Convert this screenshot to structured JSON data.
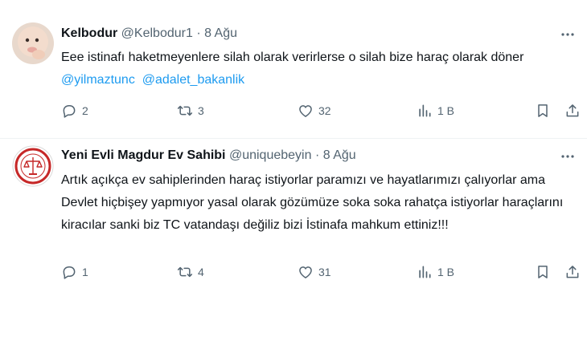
{
  "tweets": [
    {
      "name": "Kelbodur",
      "handle": "@Kelbodur1",
      "sep": "·",
      "date": "8 Ağu",
      "text": "Eee istinafı haketmeyenlere silah olarak verirlerse o silah bize haraç olarak döner ",
      "mention1": "@yilmaztunc",
      "mention2": "@adalet_bakanlik",
      "replies": "2",
      "retweets": "3",
      "likes": "32",
      "views": "1 B"
    },
    {
      "name": "Yeni Evli Magdur Ev Sahibi",
      "handle": "@uniquebeyin",
      "sep": "·",
      "date": "8 Ağu",
      "text": "Artık açıkça ev sahiplerinden haraç istiyorlar paramızı ve hayatlarımızı çalıyorlar ama Devlet hiçbişey yapmıyor yasal olarak gözümüze soka soka rahatça istiyorlar haraçlarını kiracılar sanki biz TC vatandaşı değiliz bizi İstinafa mahkum ettiniz!!!",
      "replies": "1",
      "retweets": "4",
      "likes": "31",
      "views": "1 B"
    }
  ],
  "colors": {
    "text": "#0f1419",
    "secondary": "#536471",
    "link": "#1d9bf0",
    "divider": "#eff3f4"
  },
  "icons": [
    "more-icon",
    "reply-icon",
    "retweet-icon",
    "like-icon",
    "views-icon",
    "bookmark-icon",
    "share-icon"
  ]
}
